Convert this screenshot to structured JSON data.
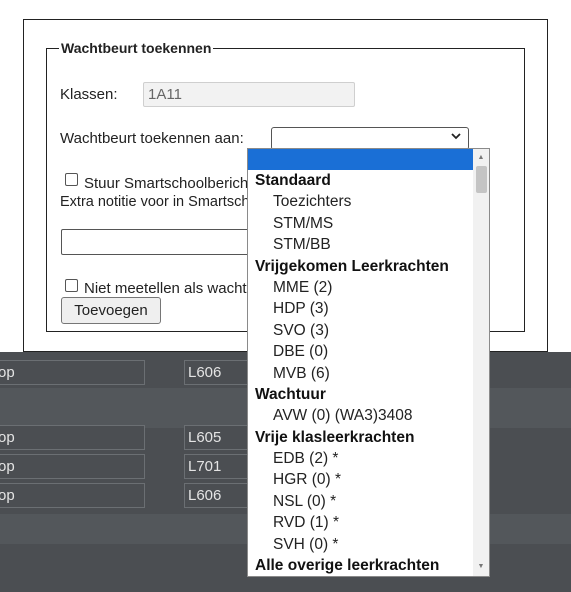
{
  "background": {
    "rows_top": [
      {
        "left": "op",
        "right": "L606"
      }
    ],
    "rows": [
      {
        "left": "op",
        "right": "L605"
      },
      {
        "left": "op",
        "right": "L701"
      },
      {
        "left": "op",
        "right": "L606"
      }
    ]
  },
  "modal": {
    "legend": "Wachtbeurt toekennen",
    "klassen_label": "Klassen:",
    "klassen_value": "1A11",
    "assign_label": "Wachtbeurt toekennen aan:",
    "select_value": "",
    "smartschool_checkbox_label": "Stuur Smartschoolbericht",
    "extra_note_label": "Extra notitie voor in Smartschoolbericht",
    "not_count_checkbox_label": "Niet meetellen als wachtbeurt",
    "add_button": "Toevoegen"
  },
  "dropdown": {
    "items": [
      {
        "text": "",
        "kind": "selected"
      },
      {
        "text": "Standaard",
        "kind": "group"
      },
      {
        "text": "Toezichters",
        "kind": "option"
      },
      {
        "text": "STM/MS",
        "kind": "option"
      },
      {
        "text": "STM/BB",
        "kind": "option"
      },
      {
        "text": "Vrijgekomen Leerkrachten",
        "kind": "group"
      },
      {
        "text": "MME (2)",
        "kind": "option"
      },
      {
        "text": "HDP (3)",
        "kind": "option"
      },
      {
        "text": "SVO (3)",
        "kind": "option"
      },
      {
        "text": "DBE (0)",
        "kind": "option"
      },
      {
        "text": "MVB (6)",
        "kind": "option"
      },
      {
        "text": "Wachtuur",
        "kind": "group"
      },
      {
        "text": "AVW (0) (WA3)3408",
        "kind": "option"
      },
      {
        "text": "Vrije klasleerkrachten",
        "kind": "group"
      },
      {
        "text": "EDB (2) *",
        "kind": "option"
      },
      {
        "text": "HGR (0) *",
        "kind": "option"
      },
      {
        "text": "NSL (0) *",
        "kind": "option"
      },
      {
        "text": "RVD (1) *",
        "kind": "option"
      },
      {
        "text": "SVH (0) *",
        "kind": "option"
      },
      {
        "text": "Alle overige leerkrachten",
        "kind": "group"
      }
    ]
  },
  "colors": {
    "selected": "#1a6fd6",
    "background_dark": "#4b4e52"
  }
}
